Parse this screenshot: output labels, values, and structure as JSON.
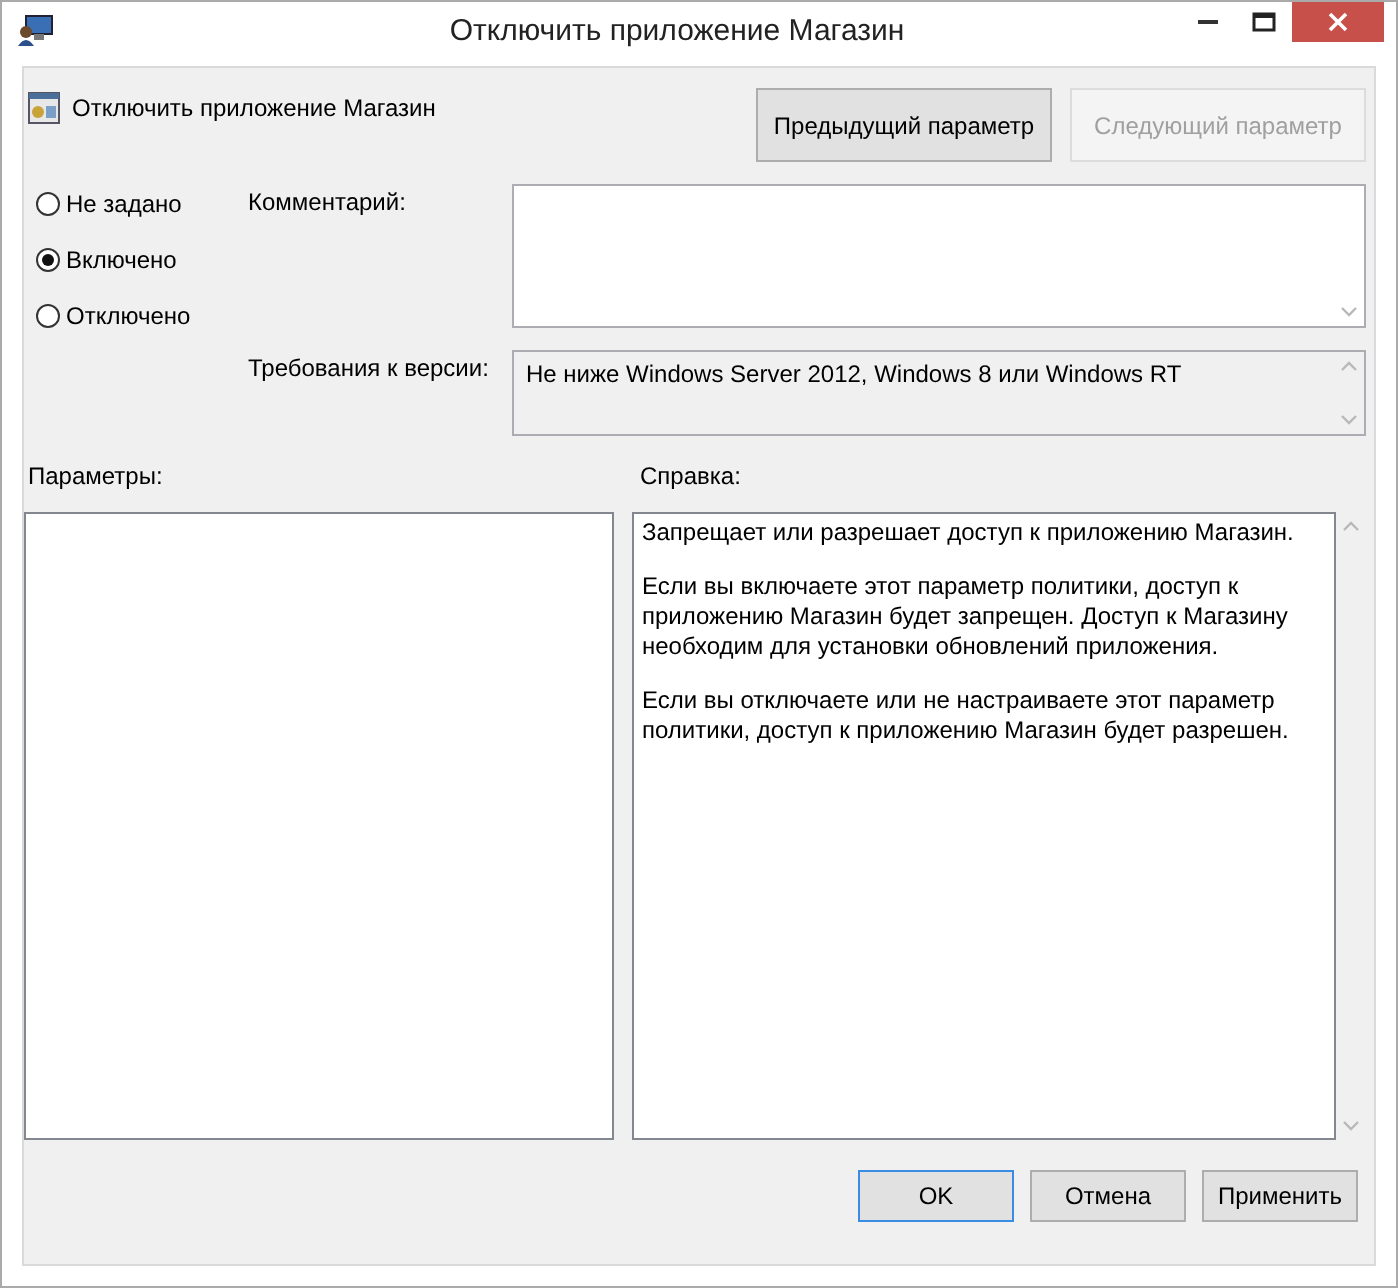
{
  "window": {
    "title": "Отключить приложение Магазин"
  },
  "header": {
    "title": "Отключить приложение Магазин"
  },
  "nav_buttons": [
    {
      "label": "Предыдущий параметр",
      "disabled": false
    },
    {
      "label": "Следующий параметр",
      "disabled": true
    }
  ],
  "state_options": [
    {
      "label": "Не задано",
      "selected": false
    },
    {
      "label": "Включено",
      "selected": true
    },
    {
      "label": "Отключено",
      "selected": false
    }
  ],
  "comment": {
    "label": "Комментарий:"
  },
  "requirements": {
    "label": "Требования к версии:",
    "value": "Не ниже Windows Server 2012, Windows 8 или Windows RT"
  },
  "options_panel": {
    "label": "Параметры:"
  },
  "help_panel": {
    "label": "Справка:",
    "paragraphs": [
      "Запрещает или разрешает доступ к приложению Магазин.",
      "Если вы включаете этот параметр политики, доступ к приложению Магазин будет запрещен. Доступ к Магазину необходим для установки обновлений приложения.",
      "Если вы отключаете или не настраиваете этот параметр политики, доступ к приложению Магазин будет разрешен."
    ]
  },
  "buttons": [
    {
      "label": "OK",
      "default": true
    },
    {
      "label": "Отмена",
      "default": false
    },
    {
      "label": "Применить",
      "default": false
    }
  ]
}
